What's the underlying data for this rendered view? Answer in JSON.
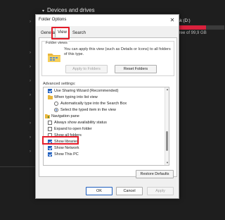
{
  "background": {
    "header": "Devices and drives",
    "drive_name": "sk (D:)",
    "drive_free": "free of 99,9 GB",
    "drive_used_fraction": 0.6,
    "accent_color": "#d9213d"
  },
  "dialog": {
    "title": "Folder Options",
    "tabs": [
      "General",
      "View",
      "Search"
    ],
    "active_tab": "View",
    "folder_views": {
      "group_label": "Folder views",
      "description": "You can apply this view (such as Details or Icons) to all folders of this type.",
      "apply_label": "Apply to Folders",
      "reset_label": "Reset Folders"
    },
    "advanced_label": "Advanced settings:",
    "tree": [
      {
        "label": "Use Sharing Wizard (Recommended)",
        "kind": "checkbox",
        "checked": true
      },
      {
        "label": "When typing into list view",
        "kind": "folder"
      },
      {
        "label": "Automatically type into the Search Box",
        "kind": "radio",
        "checked": false
      },
      {
        "label": "Select the typed item in the view",
        "kind": "radio",
        "checked": true
      },
      {
        "label": "Navigation pane",
        "kind": "folder"
      },
      {
        "label": "Always show availability status",
        "kind": "checkbox",
        "checked": false
      },
      {
        "label": "Expand to open folder",
        "kind": "checkbox",
        "checked": false
      },
      {
        "label": "Show all folders",
        "kind": "checkbox",
        "checked": false
      },
      {
        "label": "Show libraries",
        "kind": "checkbox",
        "checked": true
      },
      {
        "label": "Show Network",
        "kind": "checkbox",
        "checked": true
      },
      {
        "label": "Show This PC",
        "kind": "checkbox",
        "checked": true
      }
    ],
    "restore_label": "Restore Defaults",
    "ok_label": "OK",
    "cancel_label": "Cancel",
    "apply_label": "Apply",
    "highlight_color": "#e41d2b"
  }
}
